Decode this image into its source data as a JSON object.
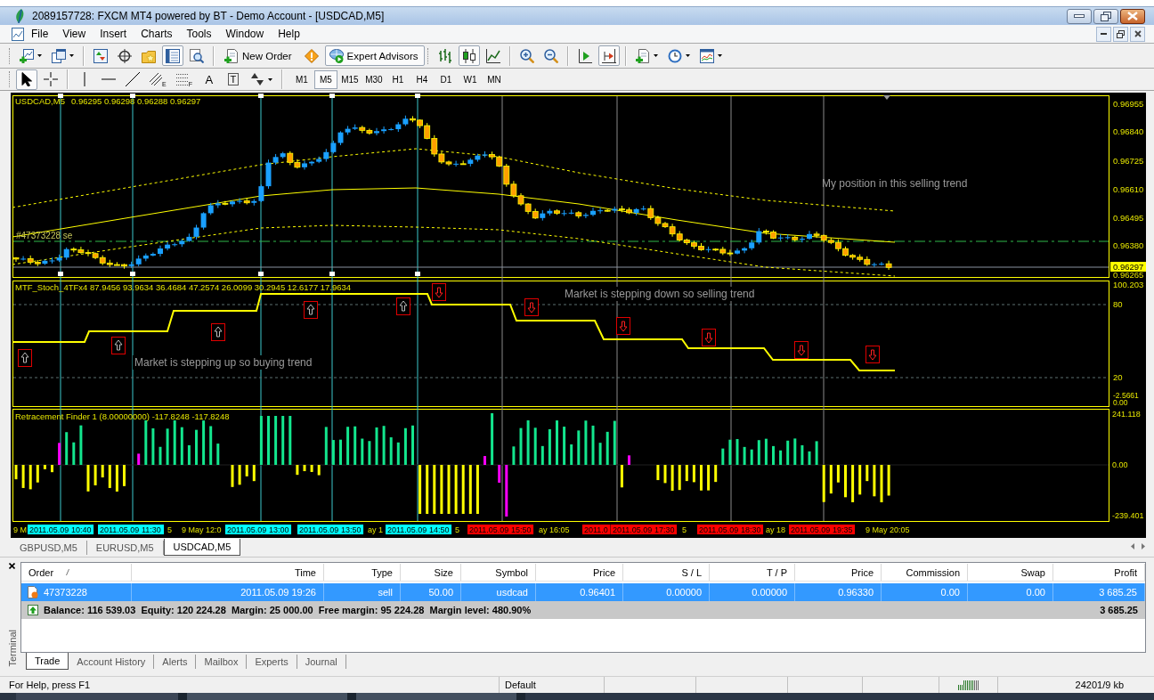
{
  "window": {
    "title": "2089157728: FXCM MT4 powered by BT - Demo Account - [USDCAD,M5]"
  },
  "menu": [
    "File",
    "View",
    "Insert",
    "Charts",
    "Tools",
    "Window",
    "Help"
  ],
  "standard_toolbar": {
    "left_buttons": [
      {
        "pressed": false
      },
      {
        "pressed": false
      },
      {
        "pressed": false
      },
      {
        "pressed": false
      },
      {
        "pressed": false
      },
      {
        "pressed": true
      },
      {
        "pressed": false
      }
    ],
    "new_order": "New Order",
    "expert_advisors": {
      "label": "Expert Advisors",
      "pressed": true
    },
    "chart_buttons": [
      {
        "pressed": false
      },
      {
        "pressed": true
      },
      {
        "pressed": false
      },
      {
        "pressed": false
      },
      {
        "pressed": false
      },
      {
        "pressed": false
      },
      {
        "pressed": true
      },
      {
        "pressed": false
      },
      {
        "pressed": false
      },
      {
        "pressed": false
      }
    ]
  },
  "drawing_toolbar": {
    "tools": [
      {
        "pressed": true
      },
      {
        "pressed": false
      },
      {
        "pressed": false
      },
      {
        "pressed": false
      },
      {
        "pressed": false
      },
      {
        "pressed": false,
        "glyph": "E"
      },
      {
        "pressed": false,
        "glyph": "F"
      },
      {
        "pressed": false,
        "glyph": "A"
      },
      {
        "pressed": false,
        "glyph": "T"
      },
      {
        "pressed": false
      }
    ],
    "timeframes": [
      {
        "label": "M1",
        "selected": false
      },
      {
        "label": "M5",
        "selected": true
      },
      {
        "label": "M15",
        "selected": false
      },
      {
        "label": "M30",
        "selected": false
      },
      {
        "label": "H1",
        "selected": false
      },
      {
        "label": "H4",
        "selected": false
      },
      {
        "label": "D1",
        "selected": false
      },
      {
        "label": "W1",
        "selected": false
      },
      {
        "label": "MN",
        "selected": false
      }
    ]
  },
  "chart": {
    "price_panel": {
      "symbol": "USDCAD,M5",
      "quote": "0.96295 0.96298 0.96288 0.96297",
      "order_label": "#47373228 se",
      "note": "My position in this selling trend",
      "scale": [
        "0.96955",
        "0.96840",
        "0.96725",
        "0.96610",
        "0.96495",
        "0.96380",
        "0.96265"
      ],
      "bid": "0.96297"
    },
    "stochastic_panel": {
      "label": "MTF_Stoch_4TFx4 87.9456 93.9634 36.4684 47.2574 26.0099 30.2945 12.6177 17.9634",
      "notes": [
        "Market is stepping down so selling trend",
        "Market is stepping up so buying trend"
      ],
      "scale": [
        "100.203",
        "80",
        "20",
        "-2.5661",
        "0.00"
      ]
    },
    "histogram_panel": {
      "label": "Retracement Finder 1 (8.00000000) -117.8248 -117.8248",
      "scale": [
        "241.118",
        "0.00",
        "-239.401"
      ]
    },
    "time_axis": [
      {
        "text": "9 M",
        "kind": "tick"
      },
      {
        "text": "2011.05.09 10:40",
        "kind": "marker",
        "color": "#00ffff"
      },
      {
        "text": "2011.05.09 11:30",
        "kind": "marker",
        "color": "#00ffff"
      },
      {
        "text": "5",
        "kind": "tick"
      },
      {
        "text": "9 May 12:0",
        "kind": "tick"
      },
      {
        "text": "2011.05.09 13:00",
        "kind": "marker",
        "color": "#00ffff"
      },
      {
        "text": "2011.05.09 13:50",
        "kind": "marker",
        "color": "#00ffff"
      },
      {
        "text": "ay 1",
        "kind": "tick"
      },
      {
        "text": "2011.05.09 14:50",
        "kind": "marker",
        "color": "#00ffff"
      },
      {
        "text": "5",
        "kind": "tick"
      },
      {
        "text": "2011.05.09 15:50",
        "kind": "marker",
        "color": "#ff0000"
      },
      {
        "text": "ay 16:05",
        "kind": "tick"
      },
      {
        "text": "2011.0",
        "kind": "marker",
        "color": "#ff0000"
      },
      {
        "text": "2011.05.09 17:30",
        "kind": "marker",
        "color": "#ff0000"
      },
      {
        "text": "5",
        "kind": "tick"
      },
      {
        "text": "2011.05.09 18:30",
        "kind": "marker",
        "color": "#ff0000"
      },
      {
        "text": "ay 18",
        "kind": "tick"
      },
      {
        "text": "2011.05.09 19:35",
        "kind": "marker",
        "color": "#ff0000"
      },
      {
        "text": "9 May 20:05",
        "kind": "tick"
      }
    ]
  },
  "chart_tabs": [
    {
      "label": "GBPUSD,M5",
      "selected": false
    },
    {
      "label": "EURUSD,M5",
      "selected": false
    },
    {
      "label": "USDCAD,M5",
      "selected": true
    }
  ],
  "terminal": {
    "title": "Terminal",
    "columns": [
      "Order",
      "Time",
      "Type",
      "Size",
      "Symbol",
      "Price",
      "S / L",
      "T / P",
      "Price",
      "Commission",
      "Swap",
      "Profit"
    ],
    "rows": [
      {
        "cells": [
          "47373228",
          "2011.05.09 19:26",
          "sell",
          "50.00",
          "usdcad",
          "0.96401",
          "0.00000",
          "0.00000",
          "0.96330",
          "0.00",
          "0.00",
          "3 685.25"
        ],
        "selected": true
      }
    ],
    "summary": {
      "text": "Balance: 116 539.03  Equity: 120 224.28  Margin: 25 000.00  Free margin: 95 224.28  Margin level: 480.90%",
      "profit": "3 685.25"
    },
    "tabs": [
      {
        "label": "Trade",
        "selected": true
      },
      {
        "label": "Account History",
        "selected": false
      },
      {
        "label": "Alerts",
        "selected": false
      },
      {
        "label": "Mailbox",
        "selected": false
      },
      {
        "label": "Experts",
        "selected": false
      },
      {
        "label": "Journal",
        "selected": false
      }
    ]
  },
  "status_bar": {
    "help": "For Help, press F1",
    "profile": "Default",
    "traffic": "24201/9 kb"
  }
}
